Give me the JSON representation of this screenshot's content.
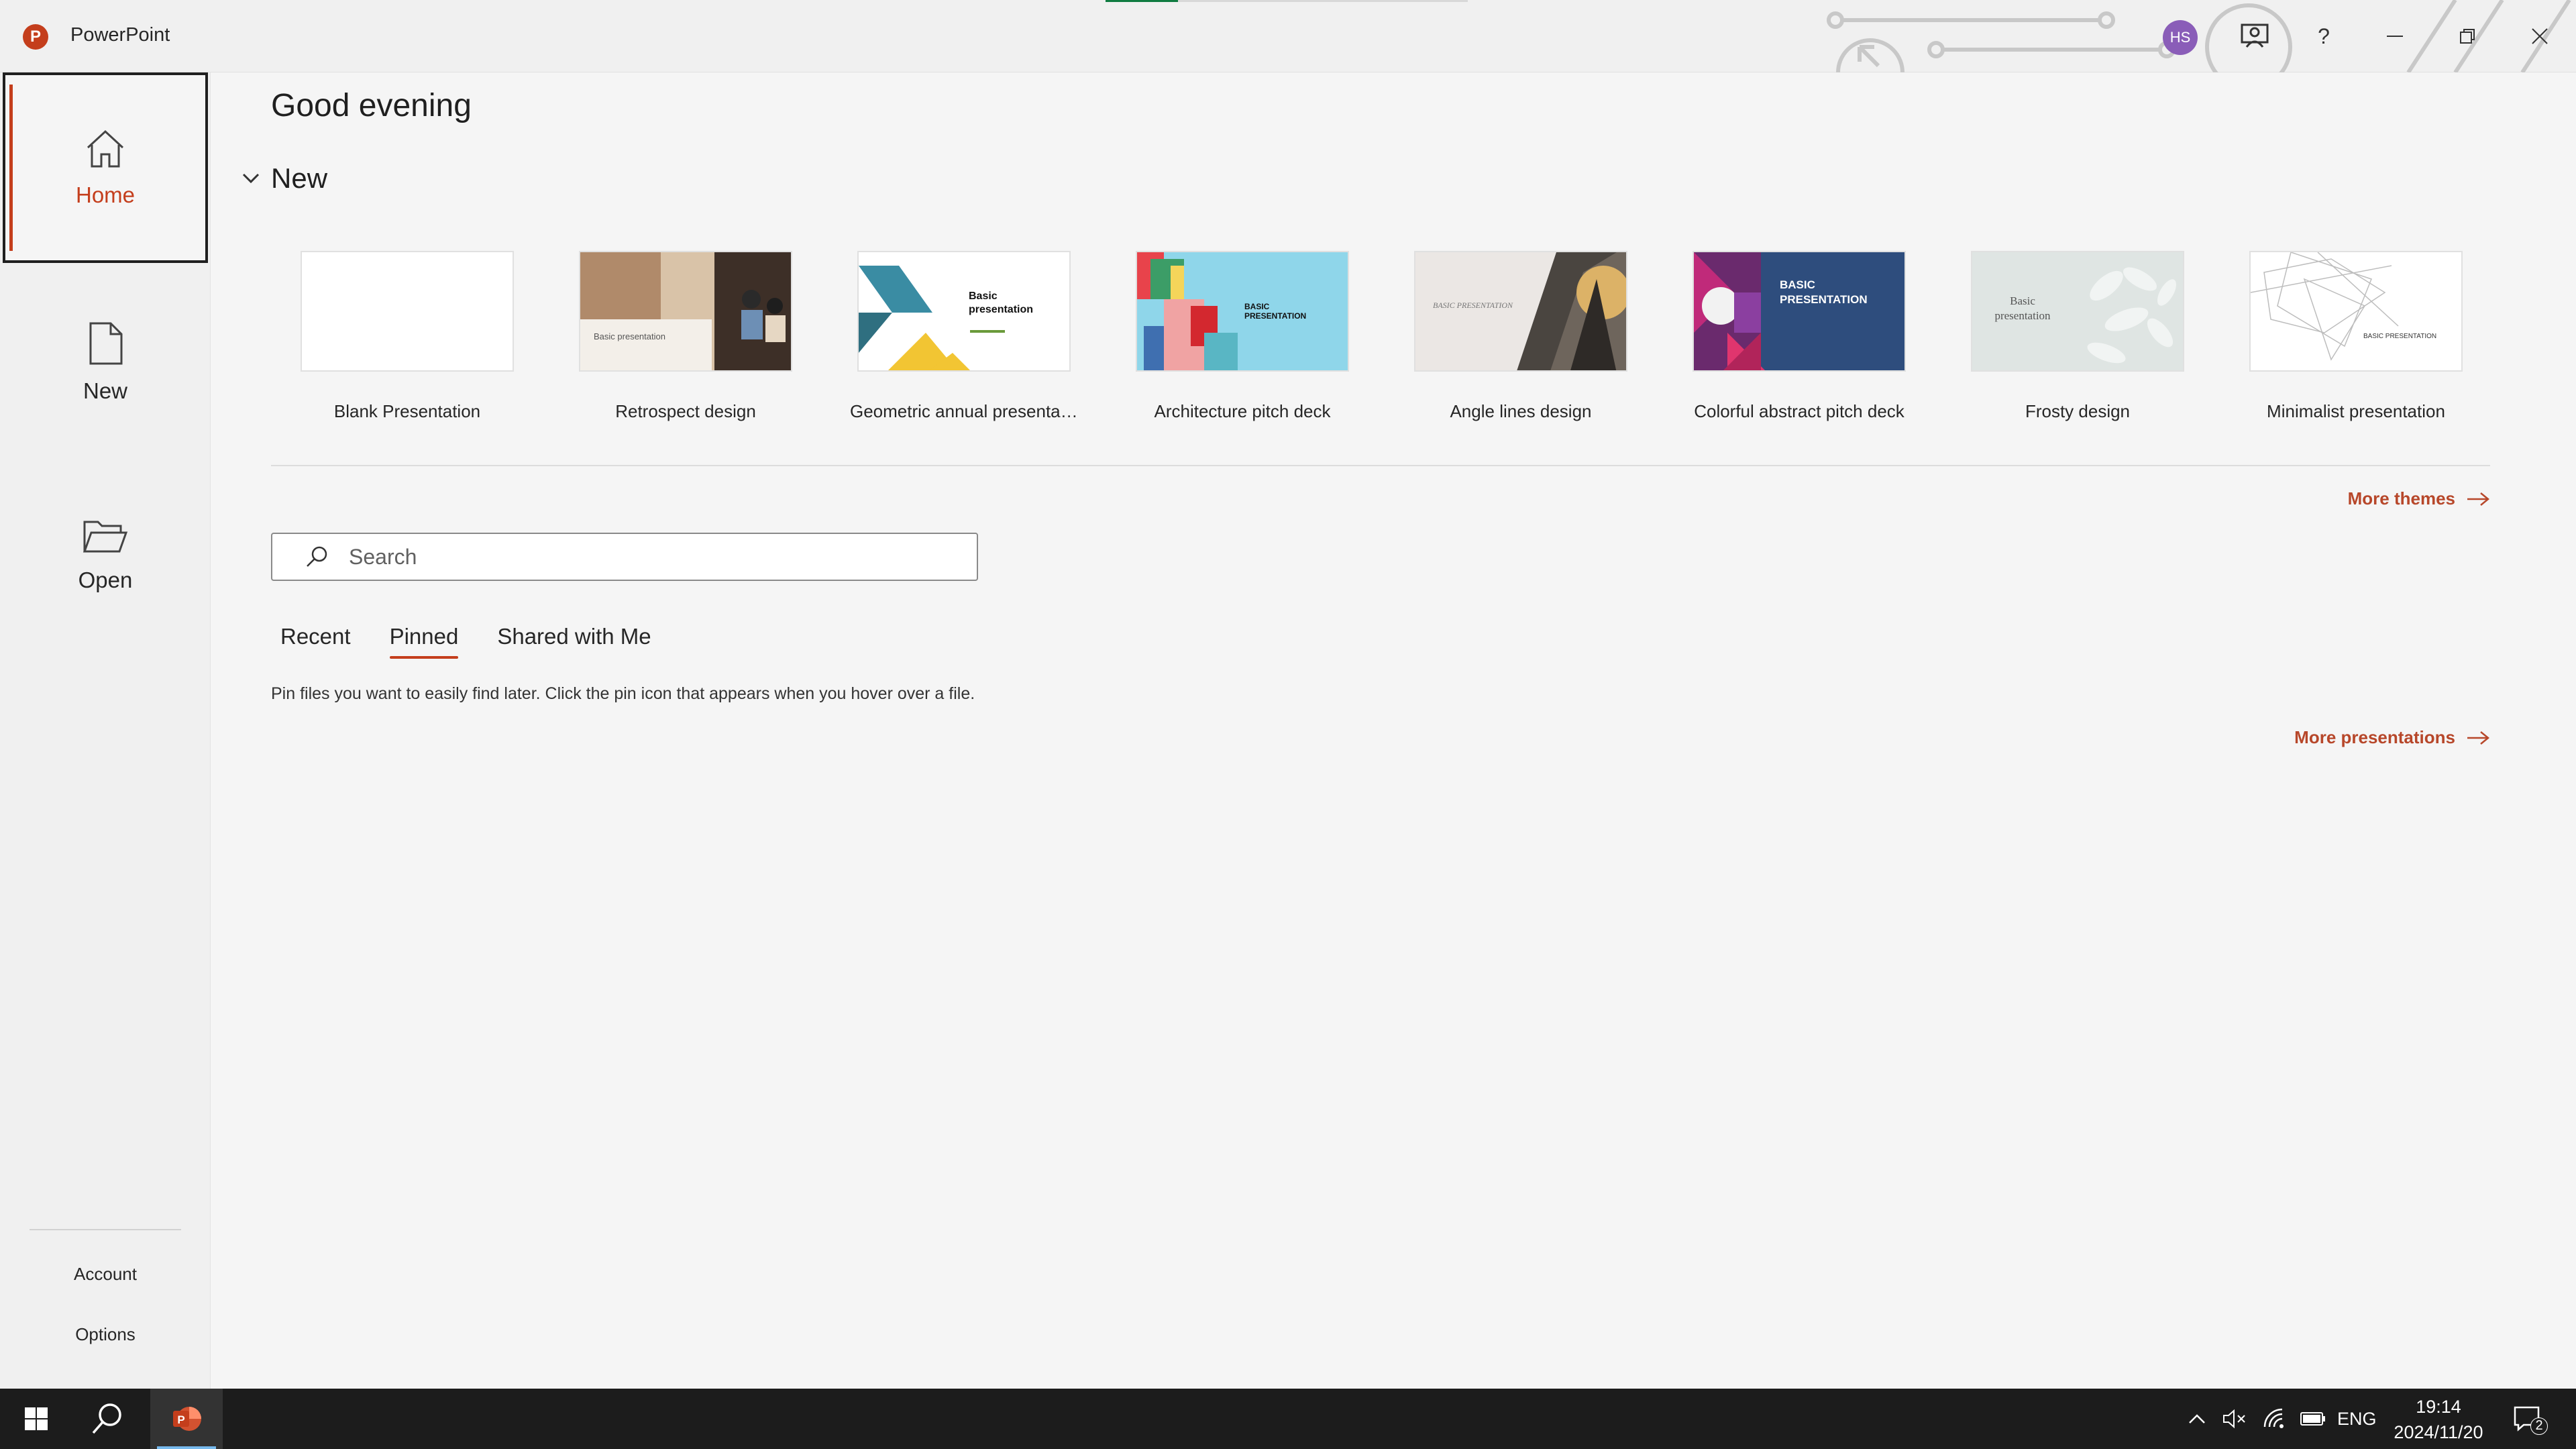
{
  "window": {
    "app_name": "PowerPoint",
    "app_logo_letter": "P",
    "user_initials": "HS",
    "help_label": "?"
  },
  "sidebar": {
    "items": [
      {
        "label": "Home",
        "icon": "home-icon",
        "active": true
      },
      {
        "label": "New",
        "icon": "new-file-icon",
        "active": false
      },
      {
        "label": "Open",
        "icon": "folder-open-icon",
        "active": false
      }
    ],
    "bottom": [
      {
        "label": "Account"
      },
      {
        "label": "Options"
      }
    ]
  },
  "main": {
    "greeting": "Good evening",
    "new_section_title": "New",
    "templates": [
      {
        "name": "Blank Presentation"
      },
      {
        "name": "Retrospect design",
        "thumb_text": "Basic presentation"
      },
      {
        "name": "Geometric annual presentat...",
        "thumb_text": "Basic presentation"
      },
      {
        "name": "Architecture pitch deck",
        "thumb_text": "BASIC PRESENTATION"
      },
      {
        "name": "Angle lines design",
        "thumb_text": "BASIC PRESENTATION"
      },
      {
        "name": "Colorful abstract pitch deck",
        "thumb_text": "BASIC PRESENTATION"
      },
      {
        "name": "Frosty design",
        "thumb_text": "Basic presentation"
      },
      {
        "name": "Minimalist presentation",
        "thumb_text": "BASIC PRESENTATION"
      }
    ],
    "more_themes": "More themes",
    "search_placeholder": "Search",
    "tabs": [
      {
        "label": "Recent",
        "active": false
      },
      {
        "label": "Pinned",
        "active": true
      },
      {
        "label": "Shared with Me",
        "active": false
      }
    ],
    "pinned_hint": "Pin files you want to easily find later. Click the pin icon that appears when you hover over a file.",
    "more_presentations": "More presentations"
  },
  "taskbar": {
    "language": "ENG",
    "time": "19:14",
    "date": "2024/11/20",
    "notification_count": "2"
  },
  "colors": {
    "accent": "#c43e1c",
    "link": "#b7472a",
    "avatar": "#8a5db8",
    "taskbar": "#1c1c1c"
  }
}
